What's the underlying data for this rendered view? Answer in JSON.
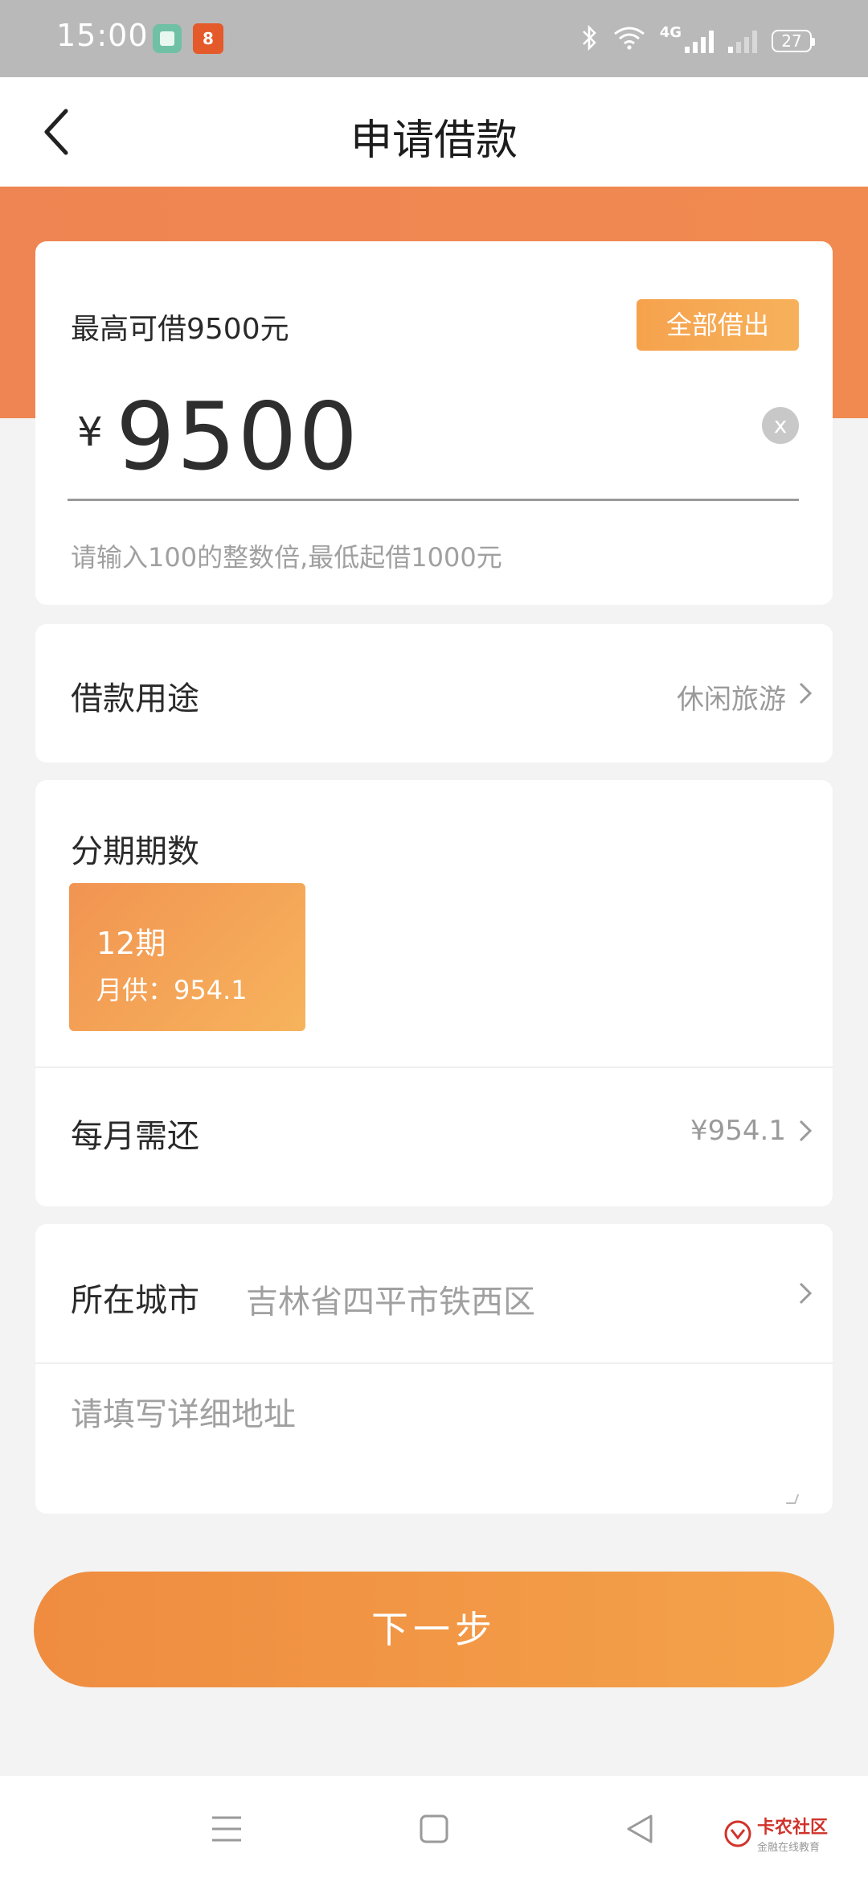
{
  "status_bar": {
    "time": "15:00",
    "app_icon_2": "8",
    "network_label": "4G",
    "battery": "27"
  },
  "header": {
    "title": "申请借款"
  },
  "amount": {
    "max_label": "最高可借9500元",
    "borrow_all_label": "全部借出",
    "currency": "¥",
    "value": "9500",
    "clear_label": "x",
    "hint": "请输入100的整数倍,最低起借1000元"
  },
  "purpose": {
    "label": "借款用途",
    "value": "休闲旅游"
  },
  "installment": {
    "label": "分期期数",
    "options": [
      {
        "period": "12期",
        "monthly": "月供：954.1",
        "selected": true
      }
    ],
    "monthly_label": "每月需还",
    "monthly_value": "¥954.1"
  },
  "city": {
    "label": "所在城市",
    "value": "吉林省四平市铁西区",
    "address_placeholder": "请填写详细地址"
  },
  "next_button": {
    "label": "下一步"
  },
  "watermark": {
    "main": "卡农社区",
    "sub": "金融在线教育"
  },
  "colors": {
    "accent": "#f18a51",
    "button": "#f09644",
    "status_bar": "#b9b9b9"
  }
}
